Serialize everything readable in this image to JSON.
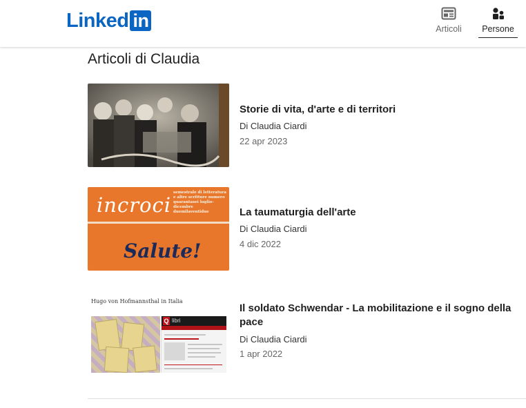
{
  "header": {
    "logo": {
      "word": "Linked",
      "box": "in"
    },
    "nav": [
      {
        "label": "Articoli",
        "icon": "newspaper-icon",
        "active": false
      },
      {
        "label": "Persone",
        "icon": "people-icon",
        "active": true
      }
    ]
  },
  "page": {
    "title": "Articoli di Claudia"
  },
  "articles": [
    {
      "title": "Storie di vita, d'arte e di territori",
      "author": "Di Claudia Ciardi",
      "date": "22 apr 2023"
    },
    {
      "title": "La taumaturgia dell'arte",
      "author": "Di Claudia Ciardi",
      "date": "4 dic 2022",
      "thumb": {
        "word": "incroci",
        "small": "semestrale di letteratura e altre scritture numero quarantasei luglio-dicembre duemilaventidue",
        "salute": "Salute!"
      }
    },
    {
      "title": "Il soldato Schwendar - La mobilitazione e il sogno della pace",
      "author": "Di Claudia Ciardi",
      "date": "1 apr 2022",
      "thumb": {
        "caption": "Hugo von Hofmannsthal in Italia",
        "q": "Q",
        "libri": "libri"
      }
    }
  ],
  "colors": {
    "brand": "#0a66c2",
    "text": "#1f1f1f",
    "muted": "#666666",
    "accent_orange": "#e8772c",
    "navy": "#1c2a59"
  }
}
